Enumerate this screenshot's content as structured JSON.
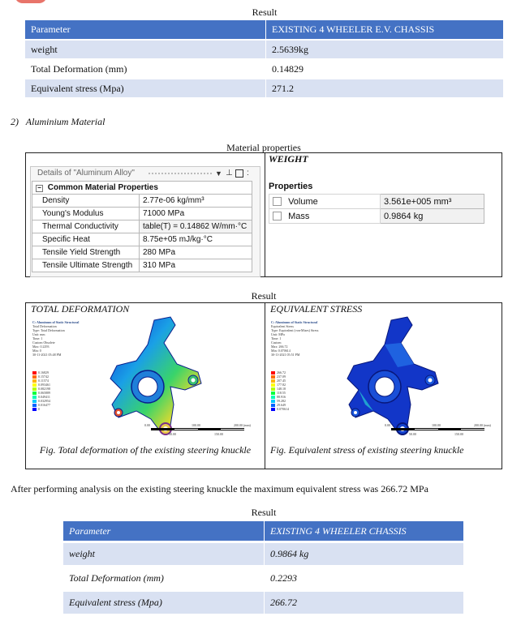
{
  "result_label_1": "Result",
  "table1": {
    "header": [
      "Parameter",
      "EXISTING 4 WHEELER E.V. CHASSIS"
    ],
    "rows": [
      [
        "weight",
        "2.5639kg"
      ],
      [
        "Total Deformation (mm)",
        "0.14829"
      ],
      [
        "Equivalent stress (Mpa)",
        "271.2"
      ]
    ]
  },
  "section_heading": "2)   Aluminium Material",
  "material_caption": "Material properties",
  "details_panel": {
    "title": "Details of \"Aluminum Alloy\"",
    "group": "Common Material Properties",
    "rows": [
      [
        "Density",
        "2.77e-06 kg/mm³"
      ],
      [
        "Young's Modulus",
        "71000 MPa"
      ],
      [
        "Thermal Conductivity",
        "table(T) = 0.14862 W/mm·°C"
      ],
      [
        "Specific Heat",
        "8.75e+05 mJ/kg·°C"
      ],
      [
        "Tensile Yield Strength",
        "280 MPa"
      ],
      [
        "Tensile Ultimate Strength",
        "310 MPa"
      ]
    ]
  },
  "weight_panel": {
    "heading": "WEIGHT",
    "properties_label": "Properties",
    "rows": [
      [
        "Volume",
        "3.561e+005 mm³"
      ],
      [
        "Mass",
        "0.9864 kg"
      ]
    ]
  },
  "result_label_2": "Result",
  "figure_left": {
    "heading": "TOTAL DEFORMATION",
    "caption": "Fig. Total deformation of the existing steering knuckle",
    "legend_lines": [
      "C: Aluminum of Static Structural",
      "Total Deformation",
      "Type: Total Deformation",
      "Unit: mm",
      "Time: 1",
      "Custom Obsolete",
      "Max: 0.2293",
      "Min: 0",
      "30-11-2021 05:48 PM"
    ],
    "legend_values": [
      "0.16829",
      "0.15742",
      "0.11574",
      "0.093461",
      "0.082198",
      "0.065889",
      "0.049411",
      "0.032954",
      "0.016477",
      "0"
    ],
    "scale_labels": [
      "0.00",
      "100.00",
      "200.00 (mm)"
    ],
    "scale_sub": [
      "50.00",
      "150.00"
    ]
  },
  "figure_right": {
    "heading": "EQUIVALENT STRESS",
    "caption": "Fig. Equivalent stress of existing steering knuckle",
    "legend_lines": [
      "C: Aluminum of Static Structural",
      "Equivalent Stress",
      "Type: Equivalent (von-Mises) Stress",
      "Unit: MPa",
      "Time: 1",
      "Custom",
      "Max: 266.72",
      "Min: 0.070614",
      "30-11-2021 05:51 PM"
    ],
    "legend_values": [
      "266.72",
      "237.09",
      "207.45",
      "177.82",
      "148.18",
      "118.55",
      "88.916",
      "59.282",
      "29.649",
      "0.070614"
    ],
    "scale_labels": [
      "0.00",
      "100.00",
      "200.00 (mm)"
    ],
    "scale_sub": [
      "50.00",
      "150.00"
    ]
  },
  "summary_sentence": "After performing analysis on the existing steering knuckle the maximum equivalent stress was 266.72 MPa",
  "result_label_3": "Result",
  "table2": {
    "header": [
      "Parameter",
      "EXISTING 4 WHEELER CHASSIS"
    ],
    "rows": [
      [
        "weight",
        "0.9864 kg"
      ],
      [
        "Total Deformation (mm)",
        "0.2293"
      ],
      [
        "Equivalent stress (Mpa)",
        "266.72"
      ]
    ]
  },
  "colors": {
    "header_blue": "#4472c4",
    "row_tint": "#d9e1f2",
    "legend": [
      "#ff0000",
      "#ff6a00",
      "#ffb400",
      "#ffff00",
      "#b4ff00",
      "#00ff3c",
      "#00ffb4",
      "#00c8ff",
      "#0064ff",
      "#0000ff"
    ]
  }
}
